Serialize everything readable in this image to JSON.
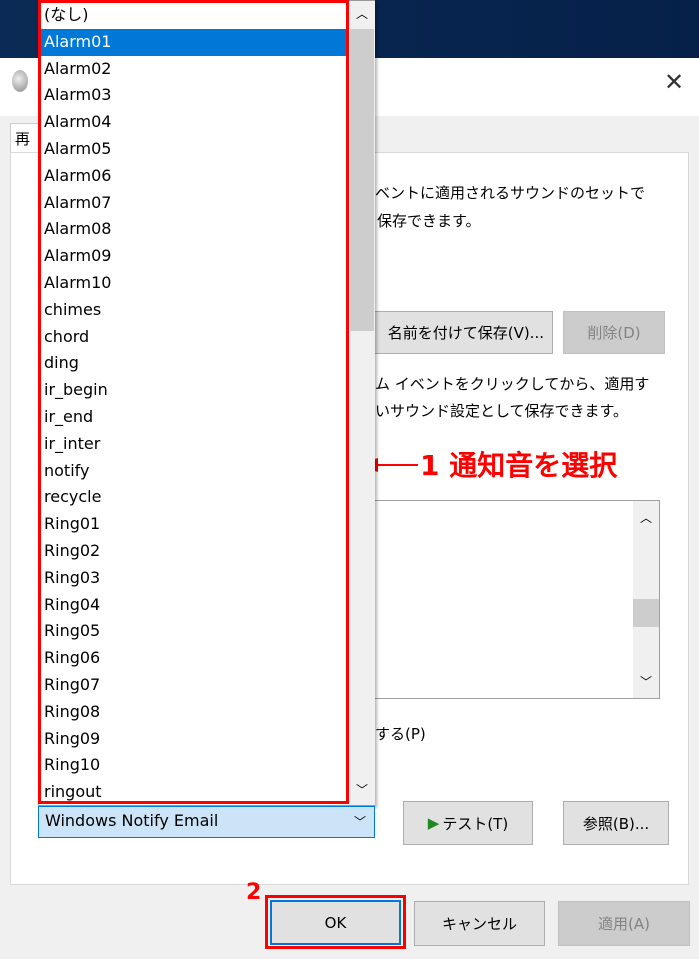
{
  "dialog": {
    "tab_label": "再",
    "desc1_line1": "ベントに適用されるサウンドのセットで",
    "desc1_line2": "保存できます。",
    "save_as": "名前を付けて保存(V)...",
    "delete": "削除(D)",
    "desc2_line1": "ム イベントをクリックしてから、適用す",
    "desc2_line2": "いサウンド設定として保存できます。",
    "checkbox_label": "する(P)",
    "test": "テスト(T)",
    "browse": "参照(B)...",
    "ok": "OK",
    "cancel": "キャンセル",
    "apply": "適用(A)"
  },
  "dropdown": {
    "selected_value": "Windows Notify Email",
    "highlighted": "Alarm01",
    "items": [
      "(なし)",
      "Alarm01",
      "Alarm02",
      "Alarm03",
      "Alarm04",
      "Alarm05",
      "Alarm06",
      "Alarm07",
      "Alarm08",
      "Alarm09",
      "Alarm10",
      "chimes",
      "chord",
      "ding",
      "ir_begin",
      "ir_end",
      "ir_inter",
      "notify",
      "recycle",
      "Ring01",
      "Ring02",
      "Ring03",
      "Ring04",
      "Ring05",
      "Ring06",
      "Ring07",
      "Ring08",
      "Ring09",
      "Ring10",
      "ringout"
    ]
  },
  "annotations": {
    "step1": "1 通知音を選択",
    "step2": "2"
  },
  "colors": {
    "annotation": "#ff0000",
    "highlight": "#0078d7"
  }
}
